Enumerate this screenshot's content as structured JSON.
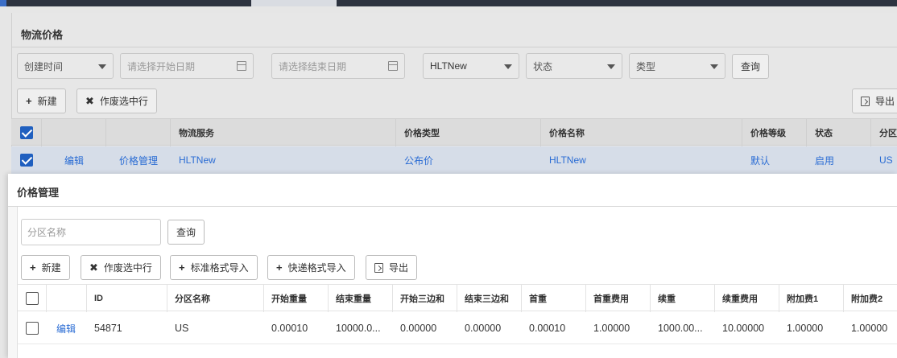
{
  "background": {
    "title": "物流价格",
    "filters": {
      "time_type": "创建时间",
      "start_date_placeholder": "请选择开始日期",
      "end_date_placeholder": "请选择结束日期",
      "service": "HLTNew",
      "status": "状态",
      "type": "类型",
      "query": "查询"
    },
    "toolbar": {
      "new": "新建",
      "void_selected": "作废选中行",
      "export": "导出"
    },
    "columns": [
      "物流服务",
      "价格类型",
      "价格名称",
      "价格等级",
      "状态",
      "分区"
    ],
    "row": {
      "edit": "编辑",
      "price_manage": "价格管理",
      "service": "HLTNew",
      "price_type": "公布价",
      "price_name": "HLTNew",
      "level": "默认",
      "status": "启用",
      "zone": "US"
    }
  },
  "modal": {
    "title": "价格管理",
    "search_placeholder": "分区名称",
    "query": "查询",
    "toolbar": {
      "new": "新建",
      "void_selected": "作废选中行",
      "import_standard": "标准格式导入",
      "import_express": "快递格式导入",
      "export": "导出"
    },
    "columns": [
      "ID",
      "分区名称",
      "开始重量",
      "结束重量",
      "开始三边和",
      "结束三边和",
      "首重",
      "首重费用",
      "续重",
      "续重费用",
      "附加费1",
      "附加费2"
    ],
    "row": {
      "edit": "编辑",
      "id": "54871",
      "zone": "US",
      "start_weight": "0.00010",
      "end_weight": "10000.0...",
      "start_sides": "0.00000",
      "end_sides": "0.00000",
      "first_weight": "0.00010",
      "first_fee": "1.00000",
      "extra_weight": "1000.00...",
      "extra_fee": "10.00000",
      "surcharge1": "1.00000",
      "surcharge2": "1.00000"
    }
  }
}
